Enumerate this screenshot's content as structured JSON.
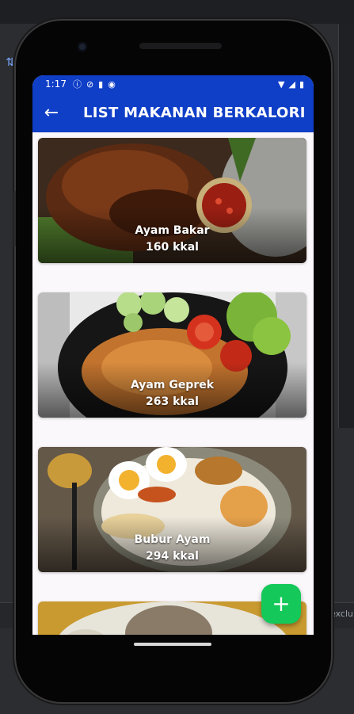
{
  "status_bar": {
    "time": "1:17",
    "left_icons": [
      "info-icon",
      "shield-icon",
      "sim-card-icon",
      "record-icon"
    ],
    "right_icons": [
      "wifi-icon",
      "signal-icon",
      "battery-icon"
    ]
  },
  "app_bar": {
    "back_icon": "arrow-left-icon",
    "title": "LIST MAKANAN BERKALORI"
  },
  "foods": [
    {
      "name": "Ayam Bakar",
      "calories": "160 kkal"
    },
    {
      "name": "Ayam Geprek",
      "calories": "263 kkal"
    },
    {
      "name": "Bubur Ayam",
      "calories": "294 kkal"
    }
  ],
  "fab": {
    "label": "+"
  },
  "ide": {
    "side_text": "exclu"
  },
  "colors": {
    "app_bar": "#0f3ec7",
    "fab": "#15c85a",
    "list_background": "#fbf8fb"
  }
}
